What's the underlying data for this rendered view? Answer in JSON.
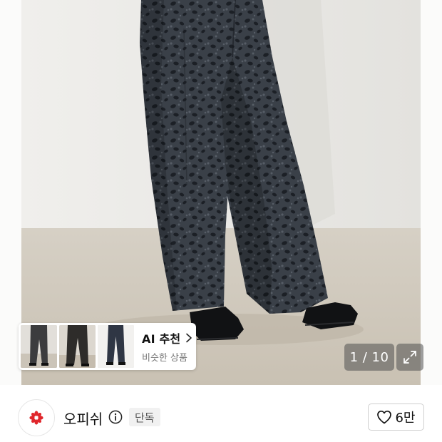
{
  "product_image": {
    "alt": "grey leopard print wide trousers",
    "background_color": "#fbfbfa",
    "wall_color": "#ecebe8",
    "floor_color": "#cfc8bb",
    "fabric_color": "#3a4048"
  },
  "ai_recommendation": {
    "title": "AI 추천",
    "subtitle": "비슷한 상품",
    "thumbnail_count": 3,
    "chevron_icon": "chevron-right-icon"
  },
  "gallery": {
    "counter": "1 / 10",
    "current": 1,
    "total": 10,
    "expand_icon": "expand-icon"
  },
  "brand": {
    "name": "오피쉬",
    "logo_color": "#e0262b",
    "info_icon": "info-icon",
    "badge": "단독"
  },
  "like": {
    "icon": "heart-icon",
    "count": "6만"
  }
}
